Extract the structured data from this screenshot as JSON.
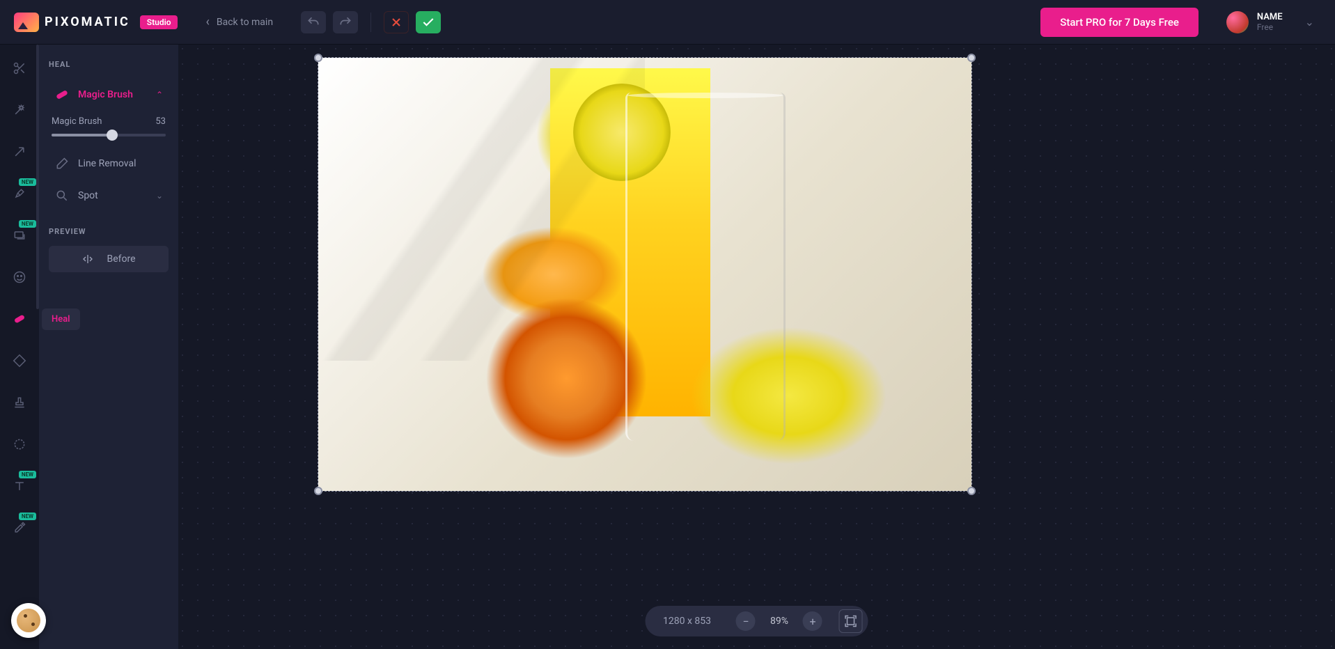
{
  "header": {
    "brand": "PIXOMATIC",
    "badge": "Studio",
    "back_label": "Back to main",
    "cta_label": "Start PRO for 7 Days Free",
    "user_name": "NAME",
    "user_plan": "Free"
  },
  "toolrail": {
    "active_tooltip": "Heal",
    "tools": [
      {
        "name": "cut-icon",
        "new": false
      },
      {
        "name": "magic-wand-icon",
        "new": false
      },
      {
        "name": "arrow-tool-icon",
        "new": false
      },
      {
        "name": "brush-icon",
        "new": true
      },
      {
        "name": "layers-icon",
        "new": true
      },
      {
        "name": "face-icon",
        "new": false
      },
      {
        "name": "heal-icon",
        "new": false,
        "active": true
      },
      {
        "name": "shape-icon",
        "new": false
      },
      {
        "name": "stamp-icon",
        "new": false
      },
      {
        "name": "gear-dashed-icon",
        "new": false
      },
      {
        "name": "text-icon",
        "new": true
      },
      {
        "name": "dropper-icon",
        "new": true
      }
    ]
  },
  "panel": {
    "title": "HEAL",
    "items": {
      "magic_brush": "Magic Brush",
      "line_removal": "Line Removal",
      "spot": "Spot"
    },
    "slider": {
      "label": "Magic Brush",
      "value": "53",
      "percent": 53
    },
    "preview_title": "PREVIEW",
    "before_label": "Before"
  },
  "canvas": {
    "width": "1280",
    "height": "853",
    "zoom": "89%"
  },
  "colors": {
    "accent": "#e91e8c",
    "bg": "#151826",
    "panel": "#1e2235",
    "green": "#27ae60",
    "red": "#e74c3c"
  }
}
